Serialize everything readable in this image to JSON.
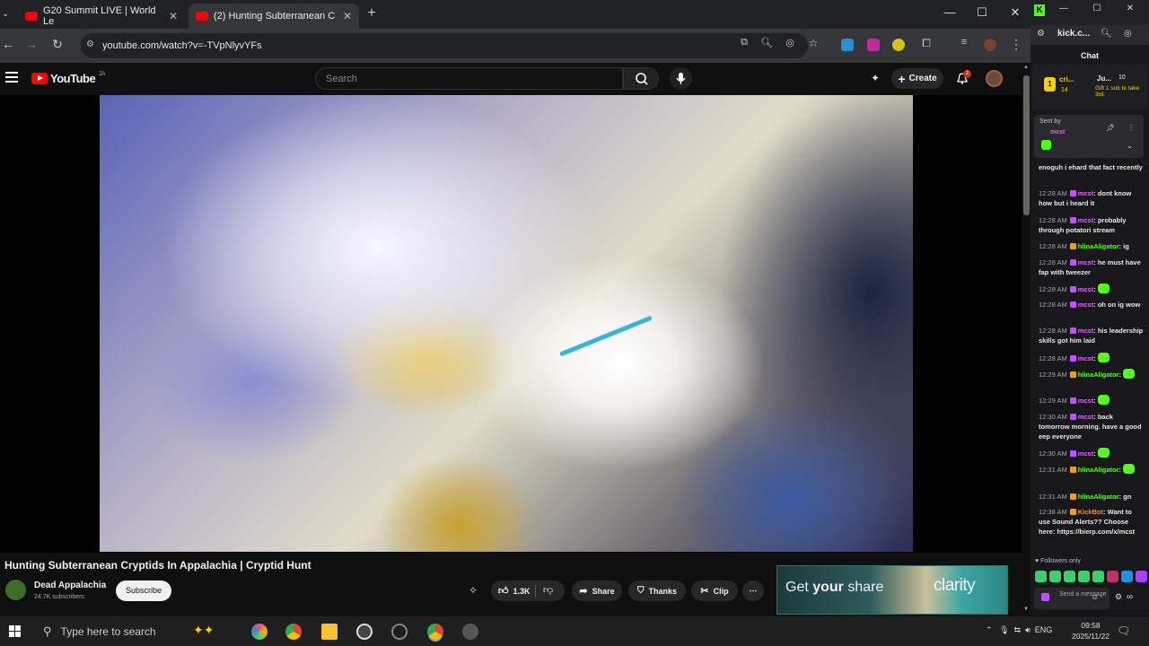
{
  "browser": {
    "tabs": [
      {
        "title": "G20 Summit LIVE | World Le"
      },
      {
        "title": "(2) Hunting Subterranean C"
      }
    ],
    "url": "youtube.com/watch?v=-TVpNlyvYFs"
  },
  "youtube": {
    "logo_text": "YouTube",
    "logo_country": "ZA",
    "search_placeholder": "Search",
    "create_label": "Create",
    "notif_count": "2"
  },
  "video": {
    "title": "Hunting Subterranean Cryptids In Appalachia | Cryptid Hunt",
    "channel": "Dead Appalachia",
    "subscribers": "24.7K subscribers",
    "subscribe_label": "Subscribe",
    "likes": "1.3K",
    "share_label": "Share",
    "thanks_label": "Thanks",
    "clip_label": "Clip"
  },
  "ad": {
    "text_prefix": "Get ",
    "text_bold": "your",
    "text_suffix": " share",
    "brand": "clarity"
  },
  "kick": {
    "site": "kick.c...",
    "chat_title": "Chat",
    "top_user": "cri...",
    "top_num": "14",
    "top_right_user": "Ju...",
    "top_right_num": "10",
    "gift_text": "Gift 1 sub to take 3rd",
    "pinned_label": "Sent by",
    "pinned_user": "mcst",
    "messages": [
      {
        "time": "",
        "user": "",
        "text": "enoguh i ehard that fact recently"
      },
      {
        "time": "12:28 AM",
        "user": "mcst",
        "text": "dont know how but i heard it"
      },
      {
        "time": "12:28 AM",
        "user": "mcst",
        "text": "probably through potatori stream"
      },
      {
        "time": "12:28 AM",
        "user": "hlinaAligator",
        "text": "ig"
      },
      {
        "time": "12:28 AM",
        "user": "mcst",
        "text": "he must have fap with tweezer"
      },
      {
        "time": "12:28 AM",
        "user": "mcst",
        "text": ""
      },
      {
        "time": "12:28 AM",
        "user": "mcst",
        "text": "oh on ig wow"
      },
      {
        "time": "12:28 AM",
        "user": "mcst",
        "text": "his leadership skills got him laid"
      },
      {
        "time": "12:28 AM",
        "user": "mcst",
        "text": ""
      },
      {
        "time": "12:29 AM",
        "user": "hlinaAligator",
        "text": ""
      },
      {
        "time": "12:29 AM",
        "user": "mcst",
        "text": ""
      },
      {
        "time": "12:30 AM",
        "user": "mcst",
        "text": "back tomorrow morning. have a good eep everyone"
      },
      {
        "time": "12:30 AM",
        "user": "mcst",
        "text": ""
      },
      {
        "time": "12:31 AM",
        "user": "hlinaAligator",
        "text": ""
      },
      {
        "time": "12:31 AM",
        "user": "hlinaAligator",
        "text": "gn"
      },
      {
        "time": "12:38 AM",
        "user": "KickBot",
        "text": "Want to use Sound Alerts?? Choose here: https://bierp.com/x/mcst"
      }
    ],
    "followers_only": "Followers only",
    "send_placeholder": "Send a message"
  },
  "taskbar": {
    "search_placeholder": "Type here to search",
    "lang": "ENG",
    "time": "09:58",
    "date": "2025/11/22"
  }
}
